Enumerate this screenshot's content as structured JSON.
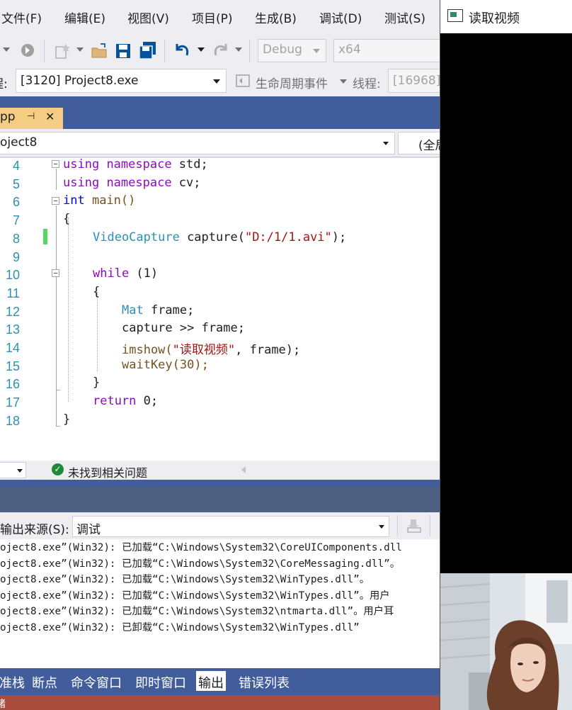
{
  "menu": {
    "items": [
      "文件(F)",
      "编辑(E)",
      "视图(V)",
      "项目(P)",
      "生成(B)",
      "调试(D)",
      "测试(S)"
    ]
  },
  "toolbar": {
    "config_combo": "Debug",
    "platform_combo": "x64"
  },
  "debug_toolbar": {
    "process_label": "程:",
    "process_value": "[3120] Project8.exe",
    "lifecycle_label": "生命周期事件",
    "thread_label": "线程:",
    "thread_value": "[16968]"
  },
  "editor_tab": {
    "label": "pp",
    "pin_glyph": "⊣",
    "close_glyph": "✕"
  },
  "navbar": {
    "project": "oject8",
    "scope": "(全局"
  },
  "code": {
    "lines": [
      {
        "num": "4"
      },
      {
        "num": "5"
      },
      {
        "num": "6"
      },
      {
        "num": "7"
      },
      {
        "num": "8"
      },
      {
        "num": "9"
      },
      {
        "num": "10"
      },
      {
        "num": "11"
      },
      {
        "num": "12"
      },
      {
        "num": "13"
      },
      {
        "num": "14"
      },
      {
        "num": "15"
      },
      {
        "num": "16"
      },
      {
        "num": "17"
      },
      {
        "num": "18"
      }
    ],
    "text": {
      "using": "using",
      "namespace": "namespace",
      "std": " std;",
      "cv": " cv;",
      "int": "int",
      "main": " main()",
      "brace_open": "{",
      "brace_close": "}",
      "VideoCapture": "VideoCapture",
      "capture_decl": " capture(",
      "path": "\"D:/1/1.avi\"",
      "close_stmt": ");",
      "while": "while",
      "cond": " (1)",
      "Mat": "Mat",
      "frame_decl": " frame;",
      "capture_read": "capture >> frame;",
      "imshow": "imshow(",
      "win_name": "\"读取视频\"",
      "imshow_rest": ", frame);",
      "waitkey": "waitKey(30);",
      "return": "return",
      "return_val": " 0;"
    }
  },
  "editor_status": {
    "issues": "未找到相关问题"
  },
  "output": {
    "source_label": "输出来源(S):",
    "source_value": "调试",
    "lines": [
      "oject8.exe”(Win32): 已加载“C:\\Windows\\System32\\CoreUIComponents.dll",
      "oject8.exe”(Win32): 已加载“C:\\Windows\\System32\\CoreMessaging.dll”。",
      "oject8.exe”(Win32): 已加载“C:\\Windows\\System32\\WinTypes.dll”。",
      "oject8.exe”(Win32): 已加载“C:\\Windows\\System32\\WinTypes.dll”。用户",
      "oject8.exe”(Win32): 已加载“C:\\Windows\\System32\\ntmarta.dll”。用户耳",
      "oject8.exe”(Win32): 已卸载“C:\\Windows\\System32\\WinTypes.dll”"
    ]
  },
  "bottom_tabs": [
    "准栈",
    "断点",
    "命令窗口",
    "即时窗口",
    "输出",
    "错误列表"
  ],
  "status_bar": {
    "text": "绪"
  },
  "cv_window": {
    "title": "读取视频"
  },
  "colors": {
    "vs_blue": "#425d9c",
    "tab_active": "#f5cc84",
    "status_bar": "#a84b3d",
    "keyword": "#0000ff",
    "type": "#2b91af",
    "string": "#a31515",
    "change_bar": "#57d863"
  }
}
